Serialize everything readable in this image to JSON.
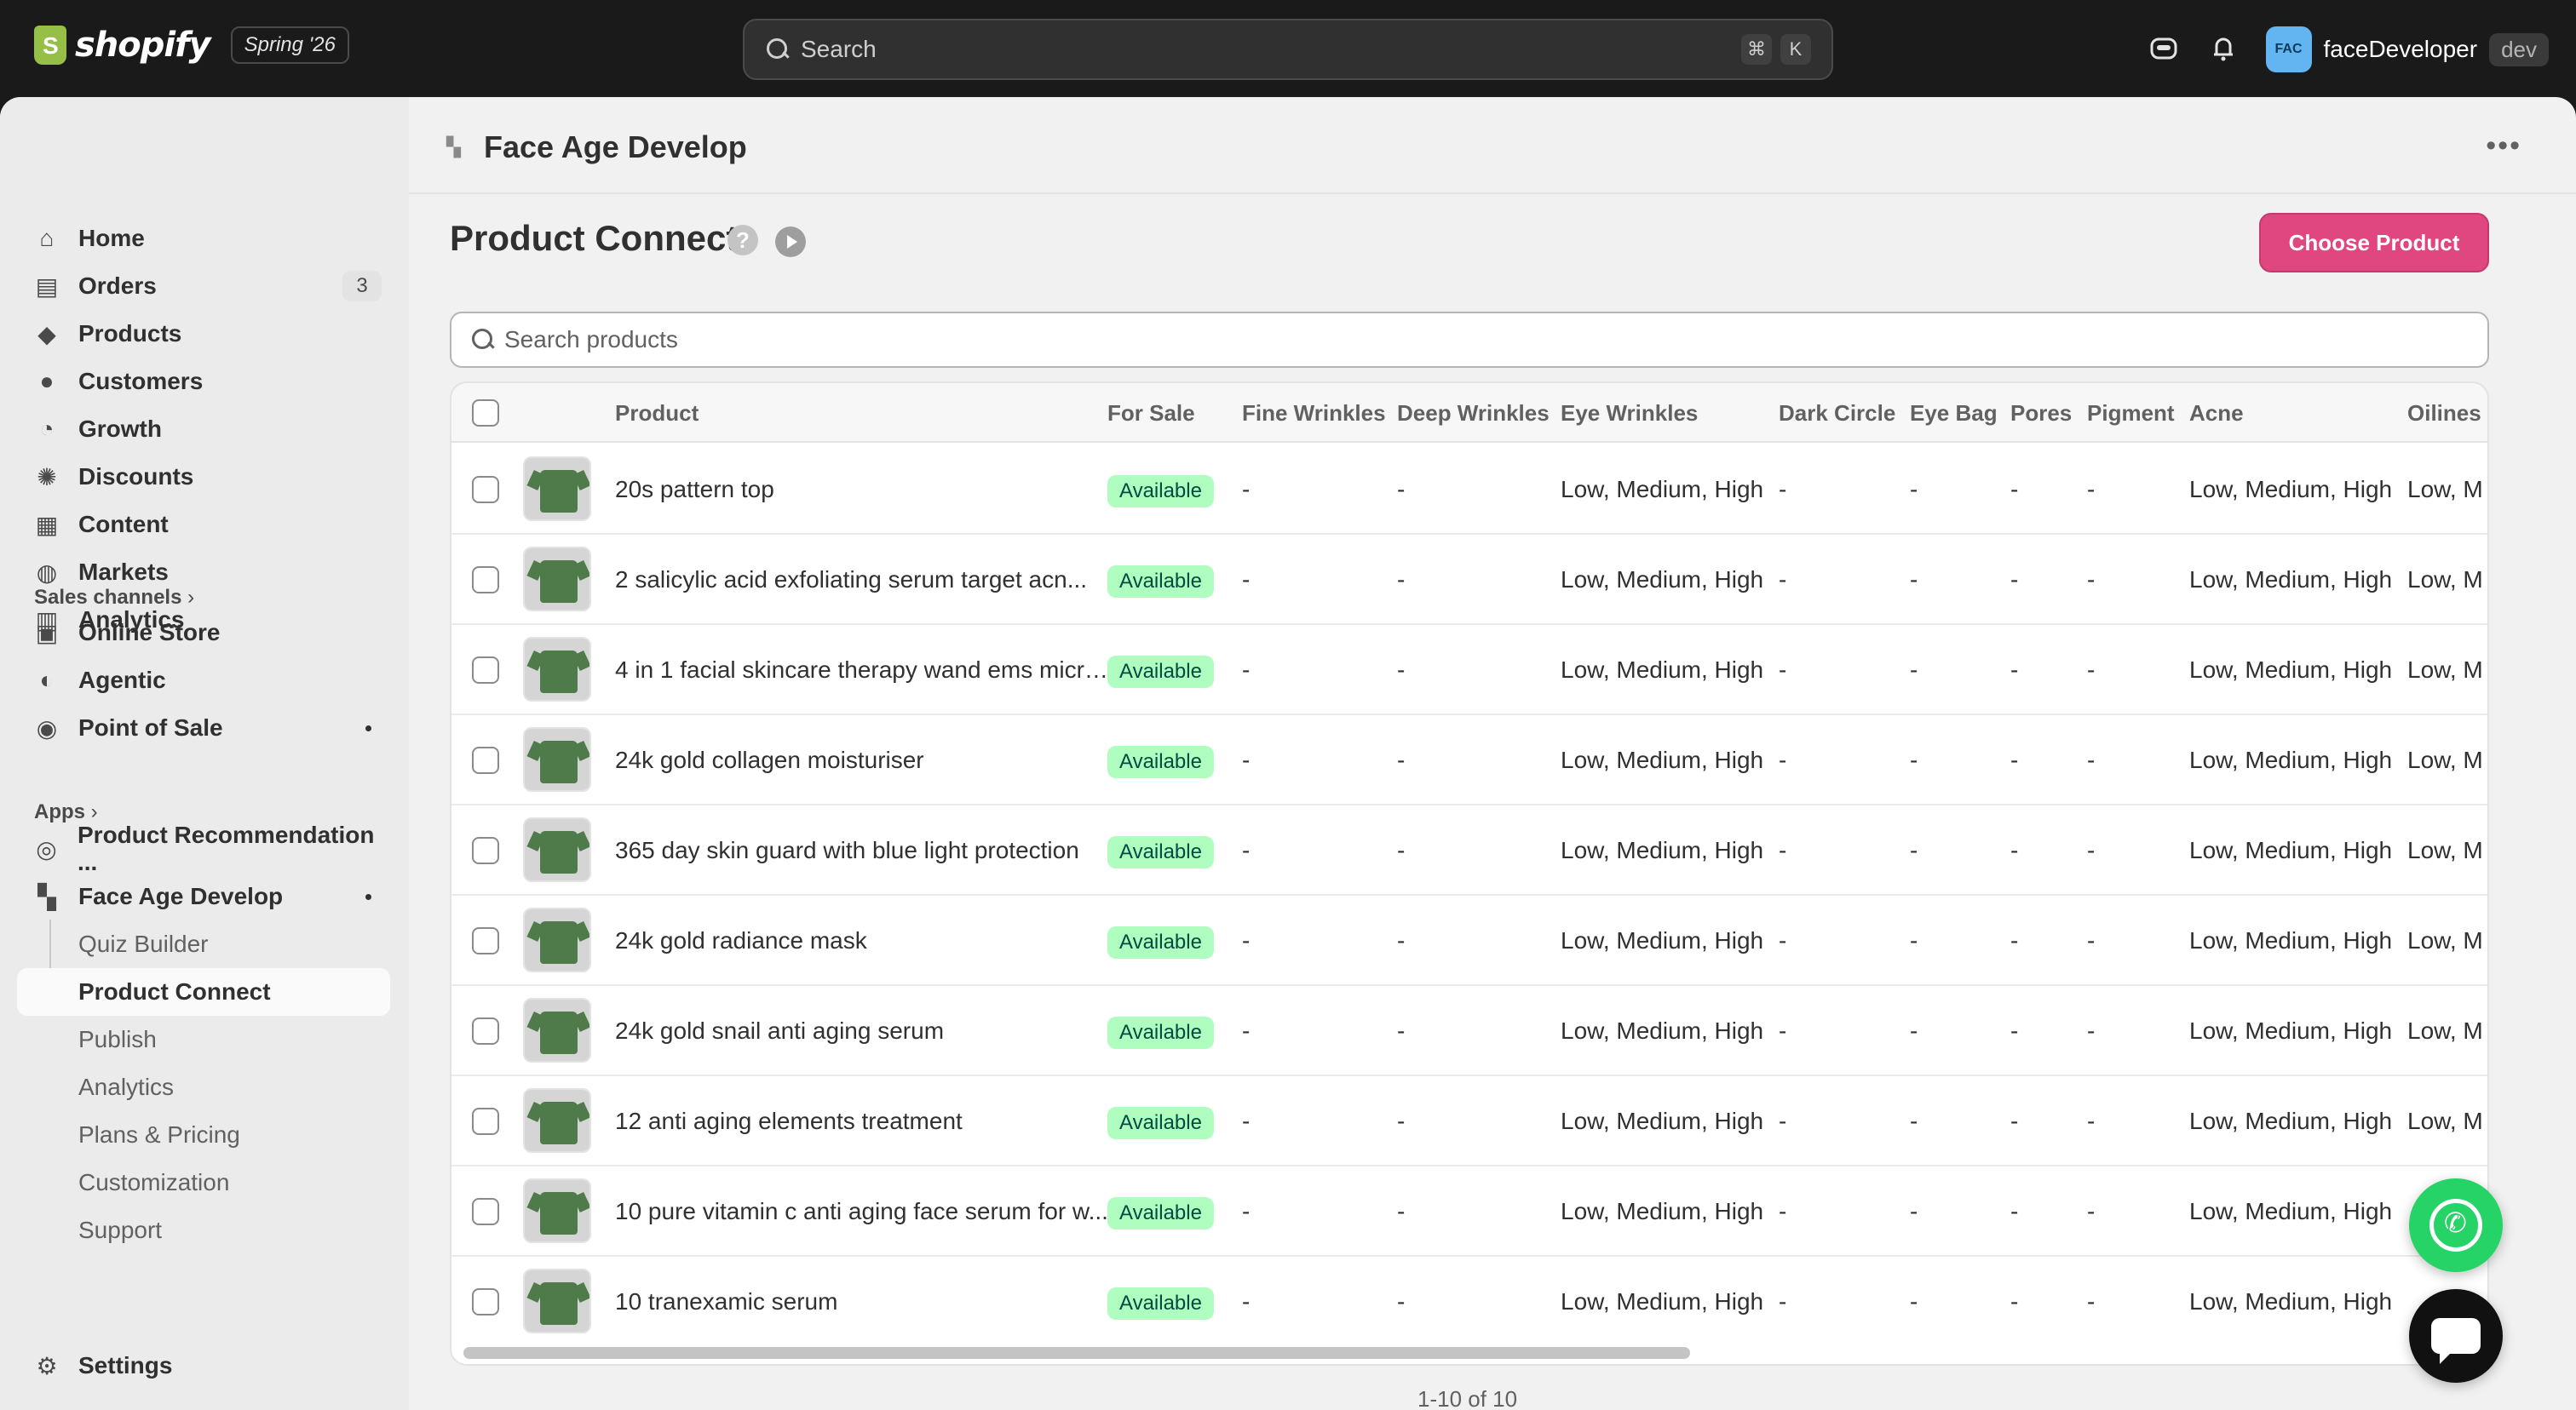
{
  "topbar": {
    "logo_text": "shopify",
    "version_badge": "Spring '26",
    "search_placeholder": "Search",
    "shortcut_keys": [
      "⌘",
      "K"
    ],
    "user": {
      "avatar": "FAC",
      "name": "faceDeveloper",
      "badge": "dev"
    },
    "icons": [
      "sidekick-icon",
      "bell-icon"
    ]
  },
  "sidebar": {
    "main_items": [
      {
        "label": "Home",
        "icon": "home-icon"
      },
      {
        "label": "Orders",
        "icon": "inbox-icon",
        "badge": "3"
      },
      {
        "label": "Products",
        "icon": "tag-icon"
      },
      {
        "label": "Customers",
        "icon": "person-icon"
      },
      {
        "label": "Growth",
        "icon": "gauge-icon"
      },
      {
        "label": "Discounts",
        "icon": "discount-icon"
      },
      {
        "label": "Content",
        "icon": "content-icon"
      },
      {
        "label": "Markets",
        "icon": "globe-icon"
      },
      {
        "label": "Analytics",
        "icon": "chart-icon"
      }
    ],
    "sales_channels_title": "Sales channels",
    "sales_channels": [
      {
        "label": "Online Store",
        "icon": "store-icon"
      },
      {
        "label": "Agentic",
        "icon": "agentic-icon"
      },
      {
        "label": "Point of Sale",
        "icon": "pos-icon"
      }
    ],
    "apps_title": "Apps",
    "apps": [
      {
        "label": "Product Recommendation ...",
        "icon": "app-icon"
      },
      {
        "label": "Face Age Develop",
        "icon": "grid-icon"
      }
    ],
    "app_subitems": [
      "Quiz Builder",
      "Product Connect",
      "Publish",
      "Analytics",
      "Plans & Pricing",
      "Customization",
      "Support"
    ],
    "active_subitem": "Product Connect",
    "settings_label": "Settings"
  },
  "app_header": {
    "title": "Face Age Develop"
  },
  "page": {
    "title": "Product Connect",
    "help_icon": "?",
    "choose_button": "Choose Product",
    "search_placeholder": "Search products",
    "pagination": "1-10 of 10"
  },
  "table": {
    "columns": [
      "Product",
      "For Sale",
      "Fine Wrinkles",
      "Deep Wrinkles",
      "Eye Wrinkles",
      "Dark Circle",
      "Eye Bag",
      "Pores",
      "Pigment",
      "Acne",
      "Oilines"
    ],
    "rows": [
      {
        "product": "20s pattern top",
        "for_sale": "Available",
        "fine": "-",
        "deep": "-",
        "eye": "Low, Medium, High",
        "dark": "-",
        "bag": "-",
        "pores": "-",
        "pigment": "-",
        "acne": "Low, Medium, High",
        "oil": "Low, M"
      },
      {
        "product": "2 salicylic acid exfoliating serum target acn...",
        "for_sale": "Available",
        "fine": "-",
        "deep": "-",
        "eye": "Low, Medium, High",
        "dark": "-",
        "bag": "-",
        "pores": "-",
        "pigment": "-",
        "acne": "Low, Medium, High",
        "oil": "Low, M"
      },
      {
        "product": "4 in 1 facial skincare therapy wand ems micro...",
        "for_sale": "Available",
        "fine": "-",
        "deep": "-",
        "eye": "Low, Medium, High",
        "dark": "-",
        "bag": "-",
        "pores": "-",
        "pigment": "-",
        "acne": "Low, Medium, High",
        "oil": "Low, M"
      },
      {
        "product": "24k gold collagen moisturiser",
        "for_sale": "Available",
        "fine": "-",
        "deep": "-",
        "eye": "Low, Medium, High",
        "dark": "-",
        "bag": "-",
        "pores": "-",
        "pigment": "-",
        "acne": "Low, Medium, High",
        "oil": "Low, M"
      },
      {
        "product": "365 day skin guard with blue light protection",
        "for_sale": "Available",
        "fine": "-",
        "deep": "-",
        "eye": "Low, Medium, High",
        "dark": "-",
        "bag": "-",
        "pores": "-",
        "pigment": "-",
        "acne": "Low, Medium, High",
        "oil": "Low, M"
      },
      {
        "product": "24k gold radiance mask",
        "for_sale": "Available",
        "fine": "-",
        "deep": "-",
        "eye": "Low, Medium, High",
        "dark": "-",
        "bag": "-",
        "pores": "-",
        "pigment": "-",
        "acne": "Low, Medium, High",
        "oil": "Low, M"
      },
      {
        "product": "24k gold snail anti aging serum",
        "for_sale": "Available",
        "fine": "-",
        "deep": "-",
        "eye": "Low, Medium, High",
        "dark": "-",
        "bag": "-",
        "pores": "-",
        "pigment": "-",
        "acne": "Low, Medium, High",
        "oil": "Low, M"
      },
      {
        "product": "12 anti aging elements treatment",
        "for_sale": "Available",
        "fine": "-",
        "deep": "-",
        "eye": "Low, Medium, High",
        "dark": "-",
        "bag": "-",
        "pores": "-",
        "pigment": "-",
        "acne": "Low, Medium, High",
        "oil": "Low, M"
      },
      {
        "product": "10 pure vitamin c anti aging face serum for w...",
        "for_sale": "Available",
        "fine": "-",
        "deep": "-",
        "eye": "Low, Medium, High",
        "dark": "-",
        "bag": "-",
        "pores": "-",
        "pigment": "-",
        "acne": "Low, Medium, High",
        "oil": ""
      },
      {
        "product": "10 tranexamic serum",
        "for_sale": "Available",
        "fine": "-",
        "deep": "-",
        "eye": "Low, Medium, High",
        "dark": "-",
        "bag": "-",
        "pores": "-",
        "pigment": "-",
        "acne": "Low, Medium, High",
        "oil": ""
      }
    ]
  },
  "colors": {
    "primary_button": "#e0467f",
    "available_badge_bg": "#affebf",
    "available_badge_text": "#014b40",
    "topbar_bg": "#1a1a1a",
    "whatsapp": "#25d366"
  }
}
